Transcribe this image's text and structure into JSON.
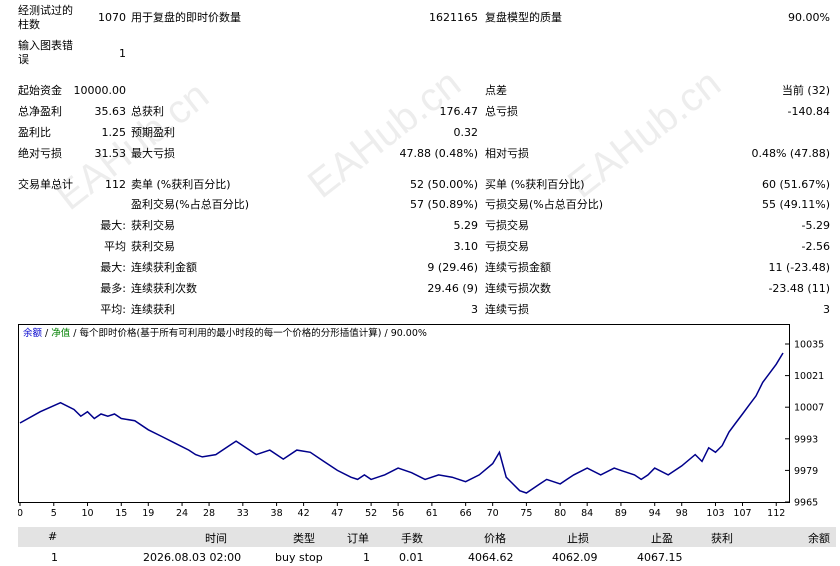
{
  "stats": {
    "bars_tested_label": [
      "经测试过的",
      "柱数"
    ],
    "bars_tested": "1070",
    "ticks_label": "用于复盘的即时价数量",
    "ticks": "1621165",
    "quality_label": "复盘模型的质量",
    "quality": "90.00%",
    "errors_label": [
      "输入图表错",
      "误"
    ],
    "errors": "1",
    "initial_deposit_label": "起始资金",
    "initial_deposit": "10000.00",
    "spread_label": "点差",
    "spread": "当前 (32)",
    "net_profit_label": "总净盈利",
    "net_profit": "35.63",
    "gross_profit_label": "总获利",
    "gross_profit": "176.47",
    "gross_loss_label": "总亏损",
    "gross_loss": "-140.84",
    "profit_factor_label": "盈利比",
    "profit_factor": "1.25",
    "expected_payoff_label": "预期盈利",
    "expected_payoff": "0.32",
    "abs_drawdown_label": "绝对亏损",
    "abs_drawdown": "31.53",
    "max_drawdown_label": "最大亏损",
    "max_drawdown": "47.88 (0.48%)",
    "rel_drawdown_label": "相对亏损",
    "rel_drawdown": "0.48% (47.88)",
    "total_trades_label": "交易单总计",
    "total_trades": "112",
    "short_label": "卖单 (%获利百分比)",
    "short": "52 (50.00%)",
    "long_label": "买单 (%获利百分比)",
    "long": "60 (51.67%)",
    "profit_trades_label": "盈利交易(%占总百分比)",
    "profit_trades": "57 (50.89%)",
    "loss_trades_label": "亏损交易(%占总百分比)",
    "loss_trades": "55 (49.11%)",
    "largest_label": "最大:",
    "largest_profit_label": "获利交易",
    "largest_profit": "5.29",
    "largest_loss_label": "亏损交易",
    "largest_loss": "-5.29",
    "average_label": "平均",
    "avg_profit_label": "获利交易",
    "avg_profit": "3.10",
    "avg_loss_label": "亏损交易",
    "avg_loss": "-2.56",
    "max_label": "最大:",
    "max_consec_wins_amt_label": "连续获利金额",
    "max_consec_wins_amt": "9 (29.46)",
    "max_consec_loss_amt_label": "连续亏损金额",
    "max_consec_loss_amt": "11 (-23.48)",
    "maximal_label": "最多:",
    "max_consec_profit_label": "连续获利次数",
    "max_consec_profit": "29.46 (9)",
    "max_consec_loss_label": "连续亏损次数",
    "max_consec_loss": "-23.48 (11)",
    "avg2_label": "平均:",
    "avg_consec_wins_label": "连续获利",
    "avg_consec_wins": "3",
    "avg_consec_losses_label": "连续亏损",
    "avg_consec_losses": "3"
  },
  "watermark": "EAHub.cn",
  "chart_header": {
    "balance": "余额",
    "sep1": " / ",
    "equity": "净值",
    "sep2": " / ",
    "model": "每个即时价格(基于所有可利用的最小时段的每一个价格的分形插值计算)",
    "sep3": " / ",
    "quality": "90.00%"
  },
  "colors": {
    "line": "#00008b",
    "balance_label": "#0000cd",
    "equity_label": "#008000",
    "header_bg": "#e3e3e3"
  },
  "chart_data": {
    "type": "line",
    "x_ticks": [
      0,
      5,
      10,
      15,
      19,
      24,
      28,
      33,
      38,
      42,
      47,
      52,
      56,
      61,
      66,
      70,
      75,
      80,
      84,
      89,
      94,
      98,
      103,
      107,
      112
    ],
    "y_ticks": [
      9965,
      9979,
      9993,
      10007,
      10021,
      10035
    ],
    "ylim": [
      9965,
      10035
    ],
    "xlim": [
      0,
      113
    ],
    "series": [
      {
        "x": [
          0,
          3,
          6,
          8,
          9,
          10,
          11,
          12,
          13,
          14,
          15,
          17,
          19,
          21,
          23,
          25,
          26,
          27,
          29,
          31,
          32,
          34,
          35,
          37,
          39,
          41,
          43,
          45,
          47,
          49,
          50,
          51,
          52,
          54,
          56,
          58,
          60,
          62,
          64,
          66,
          68,
          70,
          71,
          72,
          74,
          75,
          77,
          78,
          80,
          81,
          82,
          84,
          86,
          88,
          89,
          91,
          92,
          93,
          94,
          96,
          98,
          100,
          101,
          102,
          103,
          104,
          105,
          106,
          107,
          108,
          109,
          110,
          111,
          112,
          113
        ],
        "y": [
          10000,
          10005,
          10009,
          10006,
          10003,
          10005,
          10002,
          10004,
          10003,
          10004,
          10002,
          10001,
          9997,
          9994,
          9991,
          9988,
          9986,
          9985,
          9986,
          9990,
          9992,
          9988,
          9986,
          9988,
          9984,
          9988,
          9987,
          9983,
          9979,
          9976,
          9975,
          9977,
          9975,
          9977,
          9980,
          9978,
          9975,
          9977,
          9976,
          9974,
          9977,
          9982,
          9987,
          9976,
          9970,
          9969,
          9973,
          9975,
          9973,
          9975,
          9977,
          9980,
          9977,
          9980,
          9979,
          9977,
          9975,
          9977,
          9980,
          9977,
          9981,
          9986,
          9983,
          9989,
          9987,
          9990,
          9996,
          10000,
          10004,
          10008,
          10012,
          10018,
          10022,
          10026,
          10031
        ]
      }
    ]
  },
  "table": {
    "headers": [
      "#",
      "时间",
      "类型",
      "订单",
      "手数",
      "价格",
      "止损",
      "止盈",
      "获利",
      "余额"
    ],
    "rows": [
      [
        "1",
        "2026.08.03 02:00",
        "buy stop",
        "1",
        "0.01",
        "4064.62",
        "4062.09",
        "4067.15",
        "",
        ""
      ]
    ]
  }
}
